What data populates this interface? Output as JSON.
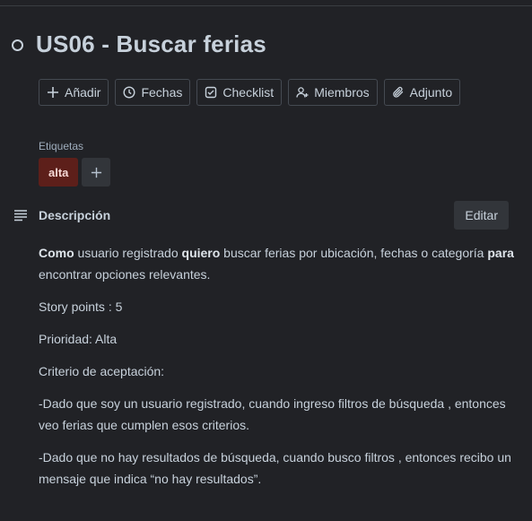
{
  "card": {
    "title": "US06 - Buscar ferias"
  },
  "actions": [
    {
      "label": "Añadir",
      "icon": "plus-icon"
    },
    {
      "label": "Fechas",
      "icon": "clock-icon"
    },
    {
      "label": "Checklist",
      "icon": "checkbox-icon"
    },
    {
      "label": "Miembros",
      "icon": "add-member-icon"
    },
    {
      "label": "Adjunto",
      "icon": "paperclip-icon"
    }
  ],
  "labels": {
    "title": "Etiquetas",
    "items": [
      {
        "text": "alta",
        "color": "#5d1f1a"
      }
    ]
  },
  "description": {
    "title": "Descripción",
    "edit_label": "Editar",
    "p1_b1": "Como",
    "p1_t1": " usuario registrado ",
    "p1_b2": "quiero",
    "p1_t2": " buscar ferias por ubicación, fechas o categoría ",
    "p1_b3": "para",
    "p1_t3": " encontrar opciones relevantes.",
    "story_points": "Story points : 5",
    "priority": "Prioridad: Alta",
    "criteria_title": "Criterio de aceptación:",
    "criteria_1": "-Dado que soy un usuario registrado, cuando ingreso filtros de búsqueda , entonces veo ferias que cumplen esos criterios.",
    "criteria_2": "-Dado que no hay resultados de búsqueda, cuando busco filtros , entonces recibo un mensaje que indica “no hay resultados”."
  }
}
